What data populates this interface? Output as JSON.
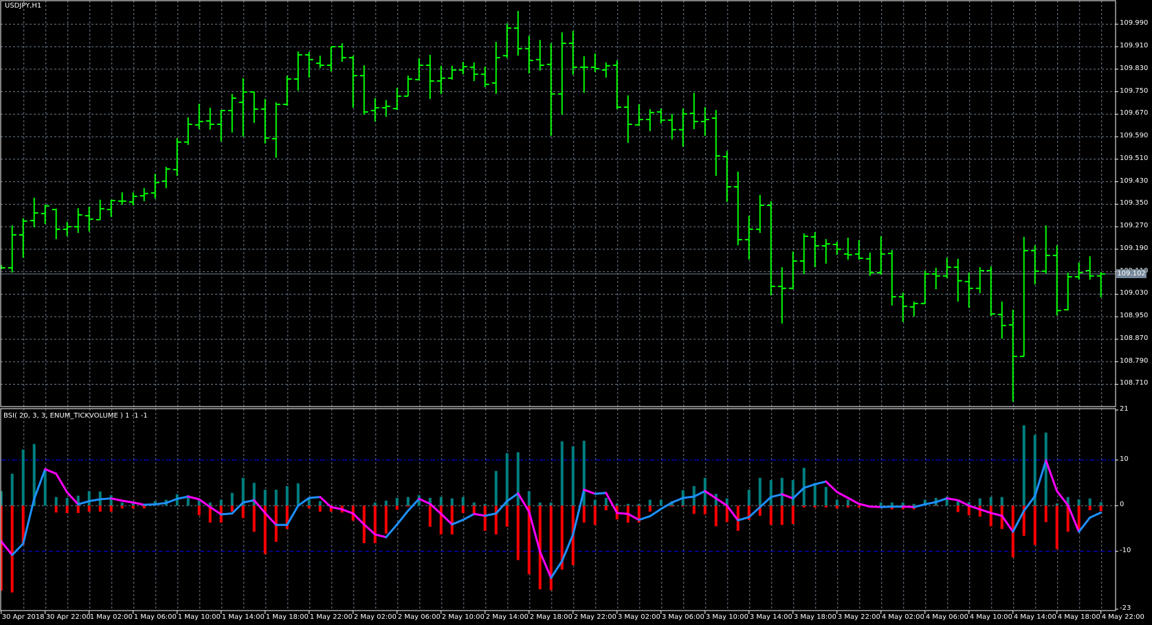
{
  "window": {
    "title": "USDJPY,H1"
  },
  "indicator": {
    "label": "BSI( 20, 3, 3, ENUM_TICKVOLUME ) 1 -1 -1"
  },
  "colors": {
    "background": "#000000",
    "bars": "#00ff00",
    "grid": "#708090",
    "buy_hist": "#008080",
    "sell_hist": "#ff0000",
    "line_up": "#1e90ff",
    "line_down": "#ff00ff",
    "levels": "#0000ff",
    "current_price_box": "#778899"
  },
  "current_price": "109.102",
  "chart_data": [
    {
      "type": "ohlc-bar",
      "title": "USDJPY,H1",
      "y_tick_labels": [
        "109.990",
        "109.910",
        "109.830",
        "109.750",
        "109.670",
        "109.590",
        "109.510",
        "109.430",
        "109.350",
        "109.270",
        "109.190",
        "109.110",
        "109.030",
        "108.950",
        "108.870",
        "108.790",
        "108.710"
      ],
      "ylim": [
        108.65,
        110.05
      ],
      "x_tick_labels": [
        "30 Apr 2018",
        "30 Apr 22:00",
        "1 May 02:00",
        "1 May 06:00",
        "1 May 10:00",
        "1 May 14:00",
        "1 May 18:00",
        "1 May 22:00",
        "2 May 02:00",
        "2 May 06:00",
        "2 May 10:00",
        "2 May 14:00",
        "2 May 18:00",
        "2 May 22:00",
        "3 May 02:00",
        "3 May 06:00",
        "3 May 10:00",
        "3 May 14:00",
        "3 May 18:00",
        "3 May 22:00",
        "4 May 02:00",
        "4 May 06:00",
        "4 May 10:00",
        "4 May 14:00",
        "4 May 18:00",
        "4 May 22:00"
      ],
      "bar_interval": "H1",
      "first_bar": "30 Apr 2018 18:00",
      "last_bar": "4 May 22:00",
      "grid": true,
      "ohlc": [
        [
          109.124,
          109.134,
          109.119,
          109.124
        ],
        [
          109.124,
          109.275,
          109.107,
          109.241
        ],
        [
          109.241,
          109.3,
          109.16,
          109.29
        ],
        [
          109.292,
          109.373,
          109.268,
          109.319
        ],
        [
          109.317,
          109.348,
          109.28,
          109.344
        ],
        [
          109.331,
          109.334,
          109.226,
          109.261
        ],
        [
          109.261,
          109.287,
          109.236,
          109.27
        ],
        [
          109.27,
          109.336,
          109.248,
          109.312
        ],
        [
          109.309,
          109.341,
          109.253,
          109.297
        ],
        [
          109.295,
          109.366,
          109.295,
          109.334
        ],
        [
          109.331,
          109.366,
          109.305,
          109.363
        ],
        [
          109.361,
          109.392,
          109.348,
          109.361
        ],
        [
          109.358,
          109.392,
          109.346,
          109.378
        ],
        [
          109.38,
          109.407,
          109.361,
          109.388
        ],
        [
          109.39,
          109.458,
          109.37,
          109.427
        ],
        [
          109.432,
          109.483,
          109.407,
          109.475
        ],
        [
          109.473,
          109.585,
          109.451,
          109.571
        ],
        [
          109.571,
          109.659,
          109.561,
          109.634
        ],
        [
          109.632,
          109.707,
          109.617,
          109.644
        ],
        [
          109.646,
          109.693,
          109.615,
          109.634
        ],
        [
          109.634,
          109.685,
          109.573,
          109.683
        ],
        [
          109.683,
          109.742,
          109.605,
          109.727
        ],
        [
          109.712,
          109.798,
          109.59,
          109.749
        ],
        [
          109.749,
          109.751,
          109.639,
          109.688
        ],
        [
          109.688,
          109.724,
          109.566,
          109.585
        ],
        [
          109.583,
          109.712,
          109.515,
          109.705
        ],
        [
          109.705,
          109.807,
          109.7,
          109.795
        ],
        [
          109.795,
          109.893,
          109.754,
          109.881
        ],
        [
          109.881,
          109.891,
          109.8,
          109.864
        ],
        [
          109.851,
          109.878,
          109.834,
          109.844
        ],
        [
          109.844,
          109.91,
          109.822,
          109.91
        ],
        [
          109.91,
          109.922,
          109.856,
          109.871
        ],
        [
          109.871,
          109.878,
          109.693,
          109.807
        ],
        [
          109.807,
          109.844,
          109.668,
          109.678
        ],
        [
          109.683,
          109.727,
          109.644,
          109.693
        ],
        [
          109.693,
          109.72,
          109.661,
          109.698
        ],
        [
          109.69,
          109.764,
          109.685,
          109.734
        ],
        [
          109.734,
          109.807,
          109.734,
          109.795
        ],
        [
          109.793,
          109.869,
          109.79,
          109.844
        ],
        [
          109.844,
          109.881,
          109.724,
          109.788
        ],
        [
          109.788,
          109.842,
          109.742,
          109.798
        ],
        [
          109.798,
          109.842,
          109.793,
          109.827
        ],
        [
          109.827,
          109.856,
          109.812,
          109.839
        ],
        [
          109.837,
          109.854,
          109.788,
          109.812
        ],
        [
          109.812,
          109.839,
          109.766,
          109.776
        ],
        [
          109.781,
          109.927,
          109.742,
          109.871
        ],
        [
          109.878,
          109.993,
          109.869,
          109.976
        ],
        [
          109.976,
          110.037,
          109.878,
          109.903
        ],
        [
          109.903,
          109.949,
          109.815,
          109.861
        ],
        [
          109.864,
          109.934,
          109.825,
          109.844
        ],
        [
          109.847,
          109.922,
          109.593,
          109.742
        ],
        [
          109.742,
          109.961,
          109.668,
          109.922
        ],
        [
          109.922,
          109.966,
          109.81,
          109.837
        ],
        [
          109.837,
          109.876,
          109.746,
          109.837
        ],
        [
          109.837,
          109.886,
          109.82,
          109.832
        ],
        [
          109.827,
          109.854,
          109.8,
          109.842
        ],
        [
          109.844,
          109.861,
          109.688,
          109.695
        ],
        [
          109.695,
          109.737,
          109.568,
          109.634
        ],
        [
          109.632,
          109.705,
          109.629,
          109.651
        ],
        [
          109.651,
          109.688,
          109.61,
          109.676
        ],
        [
          109.678,
          109.69,
          109.637,
          109.649
        ],
        [
          109.649,
          109.671,
          109.58,
          109.615
        ],
        [
          109.615,
          109.69,
          109.554,
          109.671
        ],
        [
          109.673,
          109.746,
          109.617,
          109.644
        ],
        [
          109.644,
          109.695,
          109.593,
          109.651
        ],
        [
          109.656,
          109.685,
          109.451,
          109.522
        ],
        [
          109.519,
          109.539,
          109.358,
          109.412
        ],
        [
          109.412,
          109.466,
          109.204,
          109.224
        ],
        [
          109.224,
          109.309,
          109.153,
          109.261
        ],
        [
          109.261,
          109.383,
          109.248,
          109.346
        ],
        [
          109.346,
          109.361,
          109.026,
          109.058
        ],
        [
          109.058,
          109.126,
          108.926,
          109.051
        ],
        [
          109.051,
          109.182,
          109.048,
          109.148
        ],
        [
          109.148,
          109.246,
          109.102,
          109.236
        ],
        [
          109.234,
          109.251,
          109.126,
          109.202
        ],
        [
          109.202,
          109.226,
          109.139,
          109.209
        ],
        [
          109.207,
          109.217,
          109.17,
          109.19
        ],
        [
          109.173,
          109.231,
          109.153,
          109.17
        ],
        [
          109.173,
          109.222,
          109.153,
          109.158
        ],
        [
          109.156,
          109.178,
          109.095,
          109.107
        ],
        [
          109.107,
          109.236,
          109.099,
          109.173
        ],
        [
          109.175,
          109.187,
          108.99,
          109.021
        ],
        [
          109.021,
          109.036,
          108.931,
          108.987
        ],
        [
          108.985,
          109.004,
          108.951,
          108.997
        ],
        [
          108.997,
          109.114,
          108.995,
          109.102
        ],
        [
          109.102,
          109.124,
          109.048,
          109.095
        ],
        [
          109.095,
          109.16,
          109.087,
          109.126
        ],
        [
          109.126,
          109.156,
          109.004,
          109.078
        ],
        [
          109.075,
          109.107,
          108.982,
          109.051
        ],
        [
          109.051,
          109.126,
          109.034,
          109.114
        ],
        [
          109.114,
          109.129,
          108.953,
          108.96
        ],
        [
          108.958,
          109.004,
          108.872,
          108.919
        ],
        [
          108.921,
          108.975,
          108.648,
          108.809
        ],
        [
          108.809,
          109.234,
          108.809,
          109.185
        ],
        [
          109.185,
          109.204,
          109.065,
          109.112
        ],
        [
          109.112,
          109.275,
          109.104,
          109.168
        ],
        [
          109.168,
          109.204,
          108.955,
          108.972
        ],
        [
          108.975,
          109.107,
          108.972,
          109.092
        ],
        [
          109.092,
          109.143,
          109.082,
          109.107
        ],
        [
          109.114,
          109.165,
          109.082,
          109.095
        ],
        [
          109.095,
          109.109,
          109.019,
          109.102
        ]
      ]
    },
    {
      "type": "bar+line",
      "title": "BSI( 20, 3, 3, ENUM_TICKVOLUME ) 1 -1 -1",
      "y_tick_labels": [
        "21",
        "10",
        "0",
        "-10",
        "-23"
      ],
      "ylim": [
        -23,
        21
      ],
      "levels": [
        10,
        0,
        -10
      ],
      "buy": [
        3.2,
        7.0,
        12.3,
        13.5,
        7.7,
        1.9,
        1.7,
        2.2,
        3.2,
        3.1,
        2.3,
        0.7,
        0.5,
        0,
        1.0,
        1.3,
        2.5,
        2.3,
        1.5,
        0.7,
        1.3,
        2.8,
        6.1,
        5.0,
        3.5,
        3.5,
        4.3,
        4.9,
        1.5,
        1.0,
        0,
        0,
        0,
        0,
        0.7,
        1.1,
        1.7,
        1.9,
        2.3,
        1.7,
        1.9,
        1.6,
        1.9,
        0.7,
        0.4,
        7.6,
        11.5,
        11.7,
        3.2,
        0.7,
        0.7,
        14.1,
        13.0,
        14.2,
        1.3,
        1.7,
        0.5,
        0.4,
        0.4,
        1.3,
        1.3,
        1.0,
        3.4,
        4.3,
        6.1,
        2.6,
        1.6,
        0,
        3.5,
        6.1,
        5.6,
        6.1,
        5.6,
        8.3,
        5.0,
        4.1,
        1.3,
        1.3,
        0,
        0,
        0.7,
        0.7,
        0.7,
        0.4,
        1.3,
        1.7,
        2.0,
        1.0,
        0.8,
        1.6,
        1.9,
        1.9,
        0,
        17.6,
        15.5,
        16.0,
        0.5,
        1.9,
        1.4,
        1.6,
        0.8
      ],
      "sell": [
        -18.6,
        -19.0,
        -8.6,
        0,
        0,
        -1.5,
        -1.6,
        -1.6,
        -1.3,
        -1.3,
        -1.3,
        -0.6,
        -0.6,
        -0.6,
        0,
        0,
        0,
        0,
        -2.1,
        -3.7,
        -3.7,
        -1.3,
        -2.7,
        -5.7,
        -10.6,
        -7.9,
        -5.1,
        0,
        -0.6,
        -1.3,
        -1.3,
        -1.5,
        -3.3,
        -8.2,
        -8.2,
        -6.1,
        -0.9,
        -0.2,
        0,
        -4.6,
        -6.3,
        -6.3,
        -1.6,
        -1.6,
        -5.5,
        -6.3,
        -4.6,
        -11.9,
        -15.0,
        -18.3,
        -18.5,
        -14.0,
        -13.0,
        -3.7,
        -4.2,
        -1.0,
        -3.0,
        -3.7,
        -3.7,
        -1.3,
        0,
        -0.2,
        -0.2,
        -1.8,
        -1.9,
        -4.5,
        -3.6,
        -5.5,
        -3.1,
        -2.2,
        -4.2,
        -4.2,
        -4.0,
        -0.4,
        -0.4,
        -0.4,
        -0.6,
        -0.4,
        -0.4,
        -0.4,
        0,
        -0.8,
        -0.8,
        -0.8,
        0,
        -0.1,
        0,
        -1.4,
        -2.1,
        -2.4,
        -4.5,
        -5.1,
        -11.3,
        -6.6,
        -8.6,
        -3.6,
        -9.5,
        -5.7,
        -5.7,
        -1.0,
        -1.2
      ],
      "line": [
        -7.8,
        -10.8,
        -8.3,
        1.5,
        8.0,
        7.0,
        2.9,
        0.3,
        1.0,
        1.4,
        1.6,
        1.1,
        0.7,
        0.2,
        0.3,
        0.6,
        1.5,
        2.0,
        1.4,
        -0.3,
        -1.9,
        -1.7,
        0.7,
        1.2,
        -1.6,
        -4.2,
        -4.2,
        0,
        1.7,
        1.9,
        -0.3,
        -0.8,
        -1.7,
        -4.1,
        -6.3,
        -6.9,
        -4.1,
        -1.1,
        1.5,
        0.4,
        -1.8,
        -4.1,
        -3.1,
        -1.8,
        -2.2,
        -1.7,
        1.0,
        2.7,
        -1.3,
        -10.1,
        -15.8,
        -12.1,
        -6.3,
        3.5,
        2.6,
        2.8,
        -1.6,
        -1.8,
        -3.1,
        -2.3,
        -0.7,
        0.7,
        1.7,
        2.0,
        3.2,
        1.6,
        0,
        -3.2,
        -2.5,
        -0.3,
        1.9,
        2.5,
        1.6,
        3.9,
        4.7,
        5.3,
        3.0,
        1.7,
        0.4,
        -0.2,
        -0.3,
        -0.2,
        -0.2,
        -0.3,
        0.3,
        0.8,
        1.6,
        1.2,
        0,
        -0.8,
        -1.6,
        -2.2,
        -5.7,
        -1.1,
        2.1,
        9.9,
        3.2,
        0.1,
        -5.7,
        -2.6,
        -1.5
      ]
    }
  ]
}
